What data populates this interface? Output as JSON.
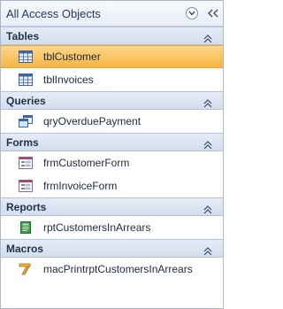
{
  "pane": {
    "title": "All Access Objects"
  },
  "groups": {
    "tables": {
      "title": "Tables",
      "items": [
        "tblCustomer",
        "tblInvoices"
      ]
    },
    "queries": {
      "title": "Queries",
      "items": [
        "qryOverduePayment"
      ]
    },
    "forms": {
      "title": "Forms",
      "items": [
        "frmCustomerForm",
        "frmInvoiceForm"
      ]
    },
    "reports": {
      "title": "Reports",
      "items": [
        "rptCustomersInArrears"
      ]
    },
    "macros": {
      "title": "Macros",
      "items": [
        "macPrintrptCustomersInArrears"
      ]
    }
  },
  "icons": {
    "table": "table-icon",
    "query": "query-icon",
    "form": "form-icon",
    "report": "report-icon",
    "macro": "macro-icon",
    "menu": "chevron-down-circle-icon",
    "shutter": "double-chevron-left-icon",
    "group_toggle": "double-chevron-up-icon"
  },
  "colors": {
    "selection": "#f7b443",
    "header": "#d3dded"
  }
}
